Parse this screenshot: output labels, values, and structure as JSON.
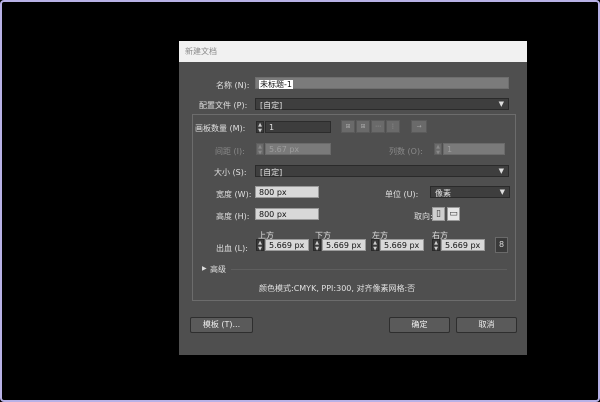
{
  "dialog": {
    "title": "新建文档",
    "name_label": "名称 (N):",
    "name_value": "未标题-1",
    "profile_label": "配置文件 (P):",
    "profile_value": "[自定]",
    "artboards_label": "画板数量 (M):",
    "artboards_value": "1",
    "spacing_label": "间距 (I):",
    "spacing_value": "5.67 px",
    "columns_label": "列数 (O):",
    "columns_value": "1",
    "size_label": "大小 (S):",
    "size_value": "[自定]",
    "width_label": "宽度 (W):",
    "width_value": "800 px",
    "units_label": "单位 (U):",
    "units_value": "像素",
    "height_label": "高度 (H):",
    "height_value": "800 px",
    "orientation_label": "取向:",
    "bleed_label": "出血 (L):",
    "bleed_top_label": "上方",
    "bleed_bottom_label": "下方",
    "bleed_left_label": "左方",
    "bleed_right_label": "右方",
    "bleed_top": "5.669 px",
    "bleed_bottom": "5.669 px",
    "bleed_left": "5.669 px",
    "bleed_right": "5.669 px",
    "advanced_label": "高级",
    "info_text": "颜色模式:CMYK, PPI:300, 对齐像素网格:否",
    "templates_button": "模板 (T)...",
    "ok_button": "确定",
    "cancel_button": "取消"
  },
  "colors": {
    "dialog_bg": "#4f4f4f",
    "frame_border": "#b8b1e6"
  }
}
